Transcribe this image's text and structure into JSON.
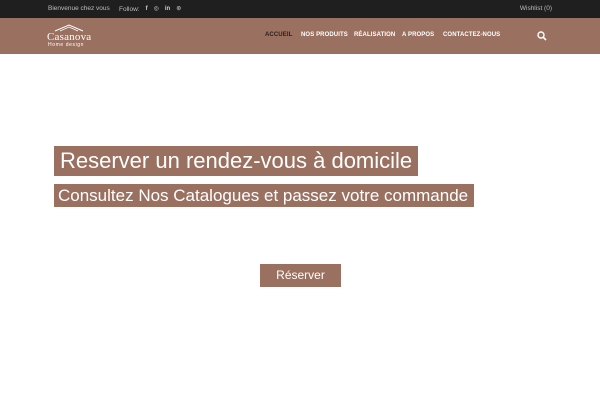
{
  "topbar": {
    "welcome": "Bienvenue chez vous",
    "follow_label": "Follow:",
    "social": [
      {
        "icon": "facebook-icon",
        "glyph": "f"
      },
      {
        "icon": "instagram-icon",
        "glyph": "◎"
      },
      {
        "icon": "linkedin-icon",
        "glyph": "in"
      },
      {
        "icon": "pinterest-icon",
        "glyph": "⊛"
      }
    ],
    "wishlist": "Wishlist (0)"
  },
  "logo": {
    "brand": "Casanova",
    "tagline": "Home design"
  },
  "nav": {
    "items": [
      {
        "label": "ACCUEIL",
        "active": true
      },
      {
        "label": "NOS PRODUITS",
        "active": false
      },
      {
        "label": "RÉALISATION",
        "active": false
      },
      {
        "label": "A PROPOS",
        "active": false
      },
      {
        "label": "CONTACTEZ-NOUS",
        "active": false
      }
    ]
  },
  "hero": {
    "title": "Reserver un rendez-vous à domicile",
    "subtitle": "Consultez Nos Catalogues et passez votre commande",
    "button": "Réserver"
  },
  "colors": {
    "brand": "#9a7060",
    "topbar": "#1f1f1f",
    "active_nav": "#2a1f1a"
  }
}
